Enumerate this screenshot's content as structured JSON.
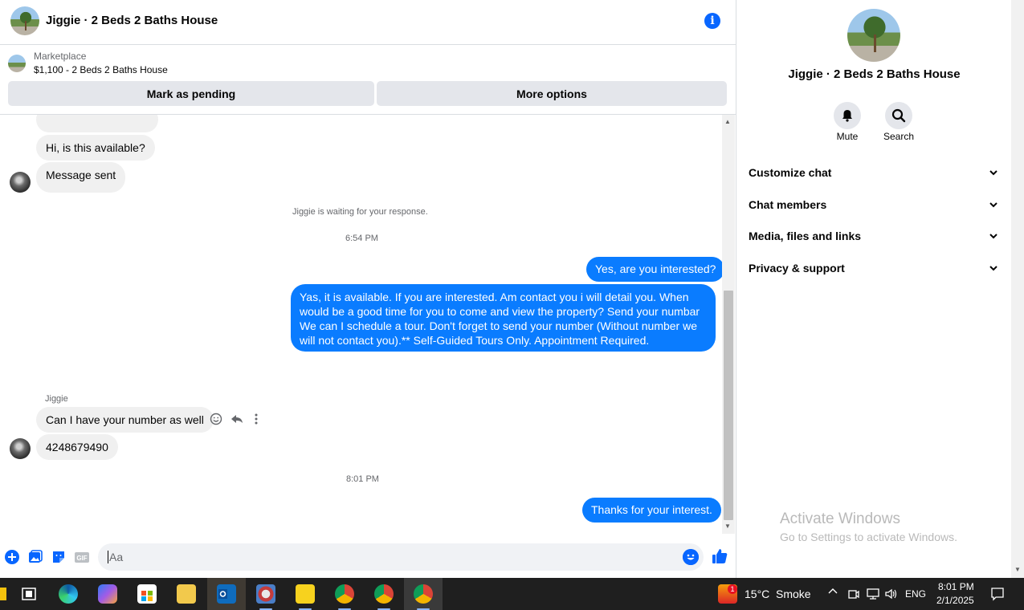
{
  "header": {
    "title": "Jiggie · 2 Beds 2 Baths House",
    "info_icon": "info-icon"
  },
  "marketplace": {
    "label": "Marketplace",
    "item": "$1,100 - 2 Beds 2 Baths House",
    "mark_pending": "Mark as pending",
    "more_options": "More options"
  },
  "messages": {
    "in_1": "Hi, is this available?",
    "in_2": "Message sent",
    "status": "Jiggie is waiting for your response.",
    "time_1": "6:54 PM",
    "out_1": "Yes, are you interested?",
    "out_2_lines": [
      "Yas, it is available. If you are interested.  Am contact you i will detail you.  When",
      "would be a good time for you to come and view the property? Send your numbar",
      "We can I schedule a tour.  Don't forget to send your number (Without number we",
      "will not contact you).** Self-Guided Tours Only. Appointment Required."
    ],
    "sender": "Jiggie",
    "in_3": "Can I have your number as well",
    "in_4": "4248679490",
    "time_2": "8:01 PM",
    "out_3": "Thanks for your interest."
  },
  "composer": {
    "placeholder": "Aa"
  },
  "panel": {
    "title": "Jiggie · 2 Beds 2 Baths House",
    "mute": "Mute",
    "search": "Search",
    "sections": [
      "Customize chat",
      "Chat members",
      "Media, files and links",
      "Privacy & support"
    ],
    "activate_title": "Activate Windows",
    "activate_sub": "Go to Settings to activate Windows."
  },
  "taskbar": {
    "weather_temp": "15°C",
    "weather_desc": "Smoke",
    "lang": "ENG",
    "time": "8:01 PM",
    "date": "2/1/2025",
    "weather_badge": "1"
  },
  "colors": {
    "accent": "#0866ff",
    "outgoing": "#0a7cff",
    "incoming": "#f0f0f0"
  }
}
